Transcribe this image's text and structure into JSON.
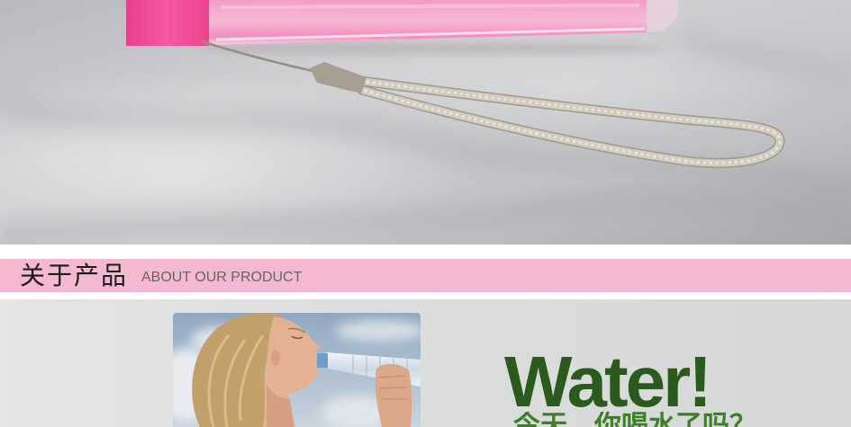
{
  "banner": {
    "title_cn": "关于产品",
    "title_en": "ABOUT OUR PRODUCT"
  },
  "promo": {
    "headline": "Water!",
    "tagline": "今天，你喝水了吗？"
  },
  "colors": {
    "banner_bg": "#f4b8d2",
    "banner_title": "#1c1c1c",
    "banner_subtitle": "#666666",
    "headline": "#2b5a1d",
    "tagline": "#3f7f2a",
    "bottle_cap": "#f04e98",
    "bottle_body": "#f6a9cd"
  }
}
